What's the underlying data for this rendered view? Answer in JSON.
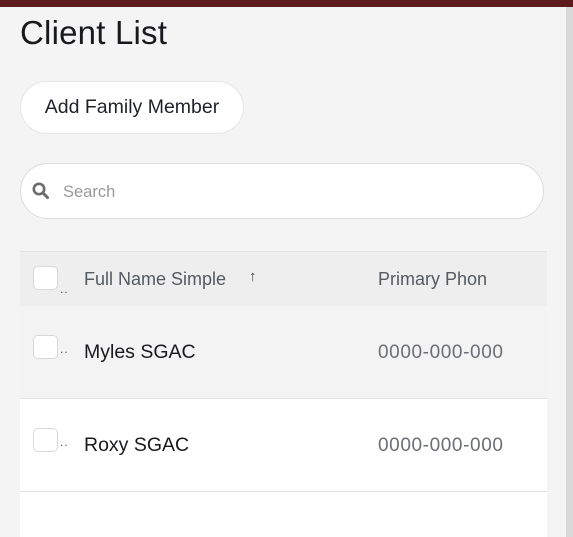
{
  "page": {
    "title": "Client List"
  },
  "actions": {
    "add_family_member": "Add Family Member"
  },
  "search": {
    "placeholder": "Search",
    "value": ""
  },
  "table": {
    "columns": {
      "name": "Full Name Simple",
      "phone": "Primary Phon",
      "sort_indicator": "↑"
    },
    "rows": [
      {
        "name": "Myles SGAC",
        "phone": "0000-000-000"
      },
      {
        "name": "Roxy SGAC",
        "phone": "0000-000-000"
      }
    ],
    "row_menu_glyph": ".."
  },
  "colors": {
    "brand_bar": "#5c1a1d",
    "background": "#f4f4f4"
  }
}
